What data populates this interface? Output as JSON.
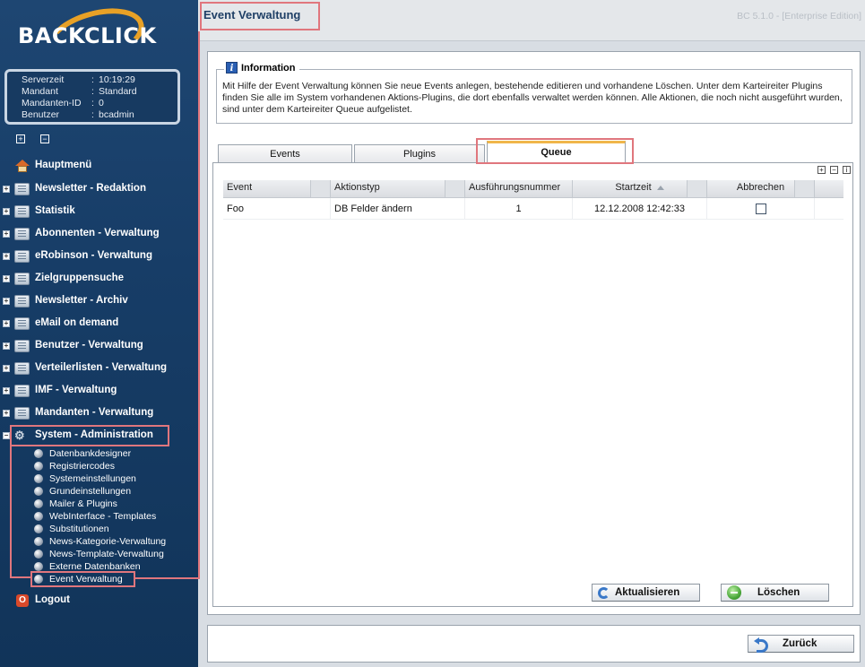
{
  "app": {
    "logo_text": "BACKCLICK",
    "version": "BC 5.1.0 - [Enterprise Edition]"
  },
  "server_info": [
    {
      "key": "Serverzeit",
      "sep": ":",
      "value": "10:19:29"
    },
    {
      "key": "Mandant",
      "sep": ":",
      "value": "Standard"
    },
    {
      "key": "Mandanten-ID",
      "sep": ":",
      "value": "0"
    },
    {
      "key": "Benutzer",
      "sep": ":",
      "value": "bcadmin"
    }
  ],
  "tree_controls": {
    "expand": "+",
    "collapse": "−"
  },
  "nav": {
    "home": "Hauptmenü",
    "items": [
      "Newsletter - Redaktion",
      "Statistik",
      "Abonnenten - Verwaltung",
      "eRobinson - Verwaltung",
      "Zielgruppensuche",
      "Newsletter - Archiv",
      "eMail on demand",
      "Benutzer - Verwaltung",
      "Verteilerlisten - Verwaltung",
      "IMF - Verwaltung",
      "Mandanten - Verwaltung"
    ],
    "system": "System - Administration",
    "system_sub": [
      "Datenbankdesigner",
      "Registriercodes",
      "Systemeinstellungen",
      "Grundeinstellungen",
      "Mailer & Plugins",
      "WebInterface - Templates",
      "Substitutionen",
      "News-Kategorie-Verwaltung",
      "News-Template-Verwaltung",
      "Externe Datenbanken",
      "Event Verwaltung"
    ],
    "logout": "Logout"
  },
  "page": {
    "title": "Event Verwaltung"
  },
  "information": {
    "legend": "Information",
    "text": "Mit Hilfe der Event Verwaltung können Sie neue Events anlegen, bestehende editieren und vorhandene Löschen. Unter dem Karteireiter Plugins finden Sie alle im System vorhandenen Aktions-Plugins, die dort ebenfalls verwaltet werden können. Alle Aktionen, die noch nicht ausgeführt wurden, sind unter dem Karteireiter Queue aufgelistet."
  },
  "tabs": [
    {
      "label": "Events",
      "active": false
    },
    {
      "label": "Plugins",
      "active": false
    },
    {
      "label": "Queue",
      "active": true
    }
  ],
  "grid": {
    "tools": [
      "+",
      "−",
      "i"
    ],
    "columns": [
      "Event",
      "Aktionstyp",
      "Ausführungsnummer",
      "Startzeit",
      "Abbrechen"
    ],
    "rows": [
      {
        "event": "Foo",
        "aktionstyp": "DB Felder ändern",
        "nummer": "1",
        "startzeit": "12.12.2008 12:42:33",
        "abbrechen": false
      }
    ]
  },
  "buttons": {
    "refresh": "Aktualisieren",
    "delete": "Löschen",
    "back": "Zurück"
  },
  "colors": {
    "sidebar": "#1e4672",
    "highlight": "#e0767d",
    "active_tab_accent": "#f0b64a",
    "title": "#1f3f66"
  }
}
